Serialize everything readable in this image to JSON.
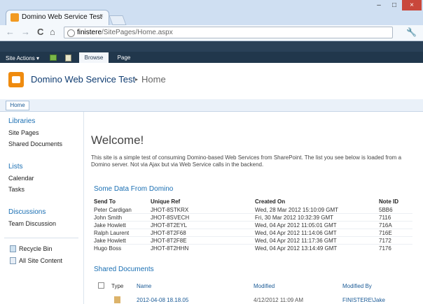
{
  "browser": {
    "tab_title": "Domino Web Service Test",
    "tab_close": "×",
    "url_host": "finistere",
    "url_path": "/SitePages/Home.aspx",
    "back": "←",
    "forward": "→",
    "reload": "C",
    "home": "⌂",
    "wrench": "🔧",
    "window_controls": [
      "–",
      "□",
      "×"
    ]
  },
  "ribbon": {
    "site_actions": "Site Actions ▾",
    "tabs": [
      "Browse",
      "Page"
    ]
  },
  "title": {
    "site": "Domino Web Service Test",
    "separator": "▸",
    "page": "Home"
  },
  "topnav": {
    "home": "Home"
  },
  "leftnav": {
    "libraries": "Libraries",
    "site_pages": "Site Pages",
    "shared_documents": "Shared Documents",
    "lists": "Lists",
    "calendar": "Calendar",
    "tasks": "Tasks",
    "discussions": "Discussions",
    "team_discussion": "Team Discussion",
    "recycle_bin": "Recycle Bin",
    "all_site_content": "All Site Content"
  },
  "main": {
    "welcome": "Welcome!",
    "intro": "This site is a simple test of consuming Domino-based Web Services from SharePoint. The list you see below is loaded from a Domino server. Not via Ajax but via Web Service calls in the backend.",
    "domino_section": "Some Data From Domino",
    "columns": [
      "Send To",
      "Unique Ref",
      "Created On",
      "Note ID"
    ],
    "rows": [
      [
        "Peter Cardigan",
        "JHOT-8STKRX",
        "Wed, 28 Mar 2012 15:10:09 GMT",
        "5BB6"
      ],
      [
        "John Smith",
        "JHOT-8SVECH",
        "Fri, 30 Mar 2012 10:32:39 GMT",
        "7116"
      ],
      [
        "Jake Howlett",
        "JHOT-8T2EYL",
        "Wed, 04 Apr 2012 11:05:01 GMT",
        "716A"
      ],
      [
        "Ralph Laurent",
        "JHOT-8T2F68",
        "Wed, 04 Apr 2012 11:14:06 GMT",
        "716E"
      ],
      [
        "Jake Howlett",
        "JHOT-8T2F8E",
        "Wed, 04 Apr 2012 11:17:36 GMT",
        "7172"
      ],
      [
        "Hugo Boss",
        "JHOT-8T2HHN",
        "Wed, 04 Apr 2012 13:14:49 GMT",
        "7176"
      ]
    ],
    "shared_section": "Shared Documents",
    "doc_columns": [
      "Type",
      "Name",
      "Modified",
      "Modified By"
    ],
    "doc_row": [
      "2012-04-08 18.18.05",
      "4/12/2012 11:09 AM",
      "FINISTERE\\Jake"
    ]
  }
}
